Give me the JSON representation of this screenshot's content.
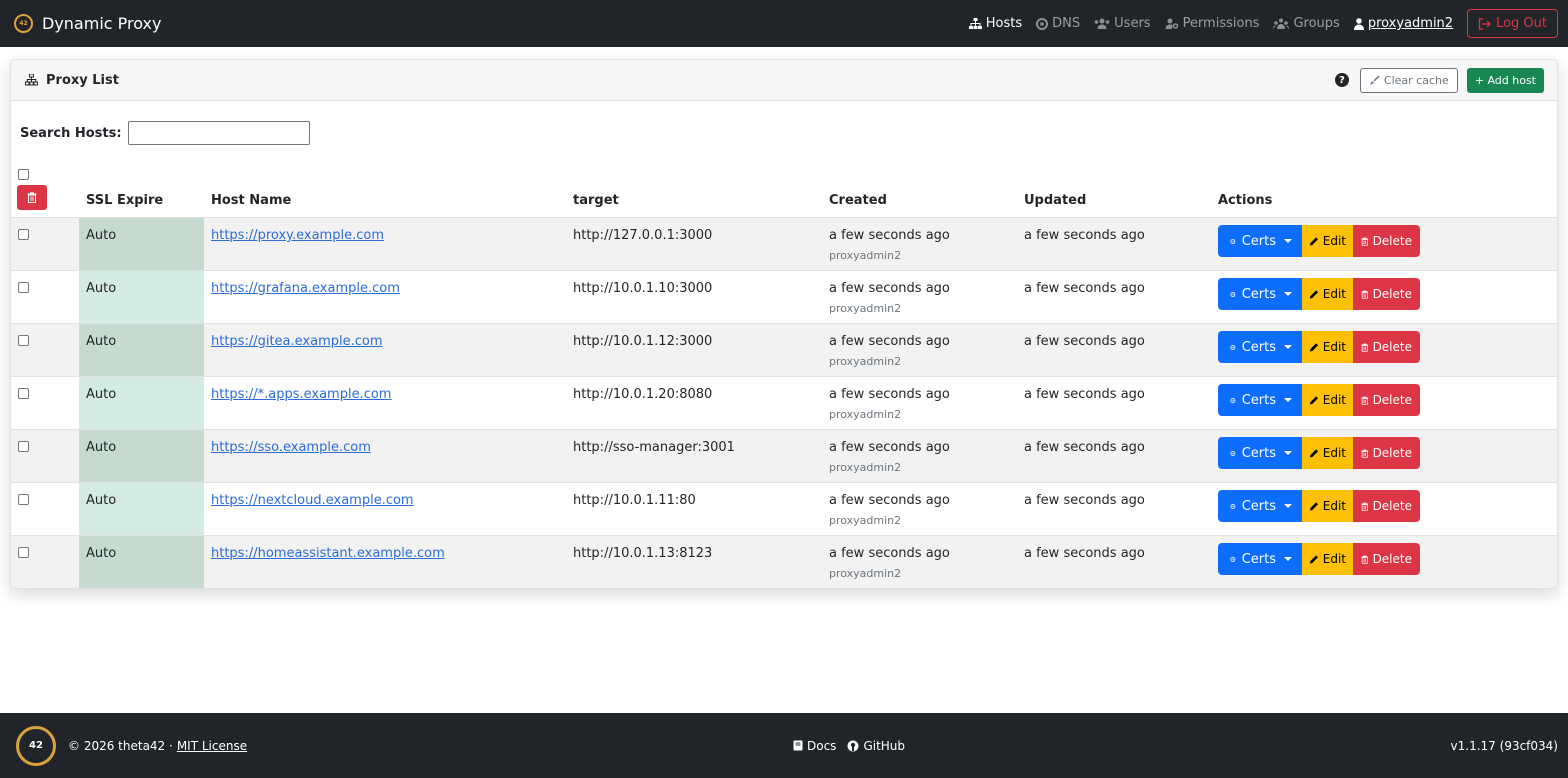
{
  "nav": {
    "brand": "Dynamic Proxy",
    "links": [
      {
        "label": "Hosts",
        "icon": "sitemap-icon",
        "active": true
      },
      {
        "label": "DNS",
        "icon": "dns-icon"
      },
      {
        "label": "Users",
        "icon": "users-icon"
      },
      {
        "label": "Permissions",
        "icon": "user-key-icon"
      },
      {
        "label": "Groups",
        "icon": "groups-icon"
      }
    ],
    "user": "proxyadmin2",
    "logout": "Log Out"
  },
  "card": {
    "title": "Proxy List",
    "help": "?",
    "clear_cache": "Clear cache",
    "add_host": "+ Add host"
  },
  "search": {
    "label": "Search Hosts:",
    "value": "",
    "placeholder": ""
  },
  "table": {
    "headers": {
      "ssl": "SSL Expire",
      "host": "Host Name",
      "target": "target",
      "created": "Created",
      "updated": "Updated",
      "actions": "Actions"
    },
    "rows": [
      {
        "ssl": "Auto",
        "host": "https://proxy.example.com",
        "target": "http://127.0.0.1:3000",
        "created": "a few seconds ago",
        "created_by": "proxyadmin2",
        "updated": "a few seconds ago"
      },
      {
        "ssl": "Auto",
        "host": "https://grafana.example.com",
        "target": "http://10.0.1.10:3000",
        "created": "a few seconds ago",
        "created_by": "proxyadmin2",
        "updated": "a few seconds ago"
      },
      {
        "ssl": "Auto",
        "host": "https://gitea.example.com",
        "target": "http://10.0.1.12:3000",
        "created": "a few seconds ago",
        "created_by": "proxyadmin2",
        "updated": "a few seconds ago"
      },
      {
        "ssl": "Auto",
        "host": "https://*.apps.example.com",
        "target": "http://10.0.1.20:8080",
        "created": "a few seconds ago",
        "created_by": "proxyadmin2",
        "updated": "a few seconds ago"
      },
      {
        "ssl": "Auto",
        "host": "https://sso.example.com",
        "target": "http://sso-manager:3001",
        "created": "a few seconds ago",
        "created_by": "proxyadmin2",
        "updated": "a few seconds ago"
      },
      {
        "ssl": "Auto",
        "host": "https://nextcloud.example.com",
        "target": "http://10.0.1.11:80",
        "created": "a few seconds ago",
        "created_by": "proxyadmin2",
        "updated": "a few seconds ago"
      },
      {
        "ssl": "Auto",
        "host": "https://homeassistant.example.com",
        "target": "http://10.0.1.13:8123",
        "created": "a few seconds ago",
        "created_by": "proxyadmin2",
        "updated": "a few seconds ago"
      }
    ],
    "actions": {
      "certs": "Certs",
      "edit": "Edit",
      "delete": "Delete"
    }
  },
  "footer": {
    "logo_text": "42",
    "copyright": "© 2026 theta42 ·",
    "license": "MIT License",
    "docs": "Docs",
    "github": "GitHub",
    "version": "v1.1.17 (93cf034)"
  },
  "colors": {
    "navbar": "#212529",
    "primary": "#0d6efd",
    "warning": "#ffc107",
    "danger": "#dc3545",
    "success": "#198754",
    "ssl_cell_odd": "#c5dbd0",
    "ssl_cell_even": "#d3ebe0",
    "link": "#2b6cd4"
  }
}
